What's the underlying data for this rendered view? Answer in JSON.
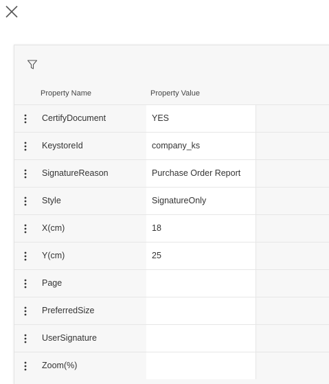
{
  "header": {
    "property_name": "Property Name",
    "property_value": "Property Value"
  },
  "icons": {
    "close": "close-icon",
    "filter": "filter-icon",
    "row_menu": "more-vertical-icon"
  },
  "rows": [
    {
      "name": "CertifyDocument",
      "value": "YES"
    },
    {
      "name": "KeystoreId",
      "value": "company_ks"
    },
    {
      "name": "SignatureReason",
      "value": "Purchase Order Report"
    },
    {
      "name": "Style",
      "value": "SignatureOnly"
    },
    {
      "name": "X(cm)",
      "value": "18"
    },
    {
      "name": "Y(cm)",
      "value": "25"
    },
    {
      "name": "Page",
      "value": ""
    },
    {
      "name": "PreferredSize",
      "value": ""
    },
    {
      "name": "UserSignature",
      "value": ""
    },
    {
      "name": "Zoom(%)",
      "value": ""
    }
  ]
}
